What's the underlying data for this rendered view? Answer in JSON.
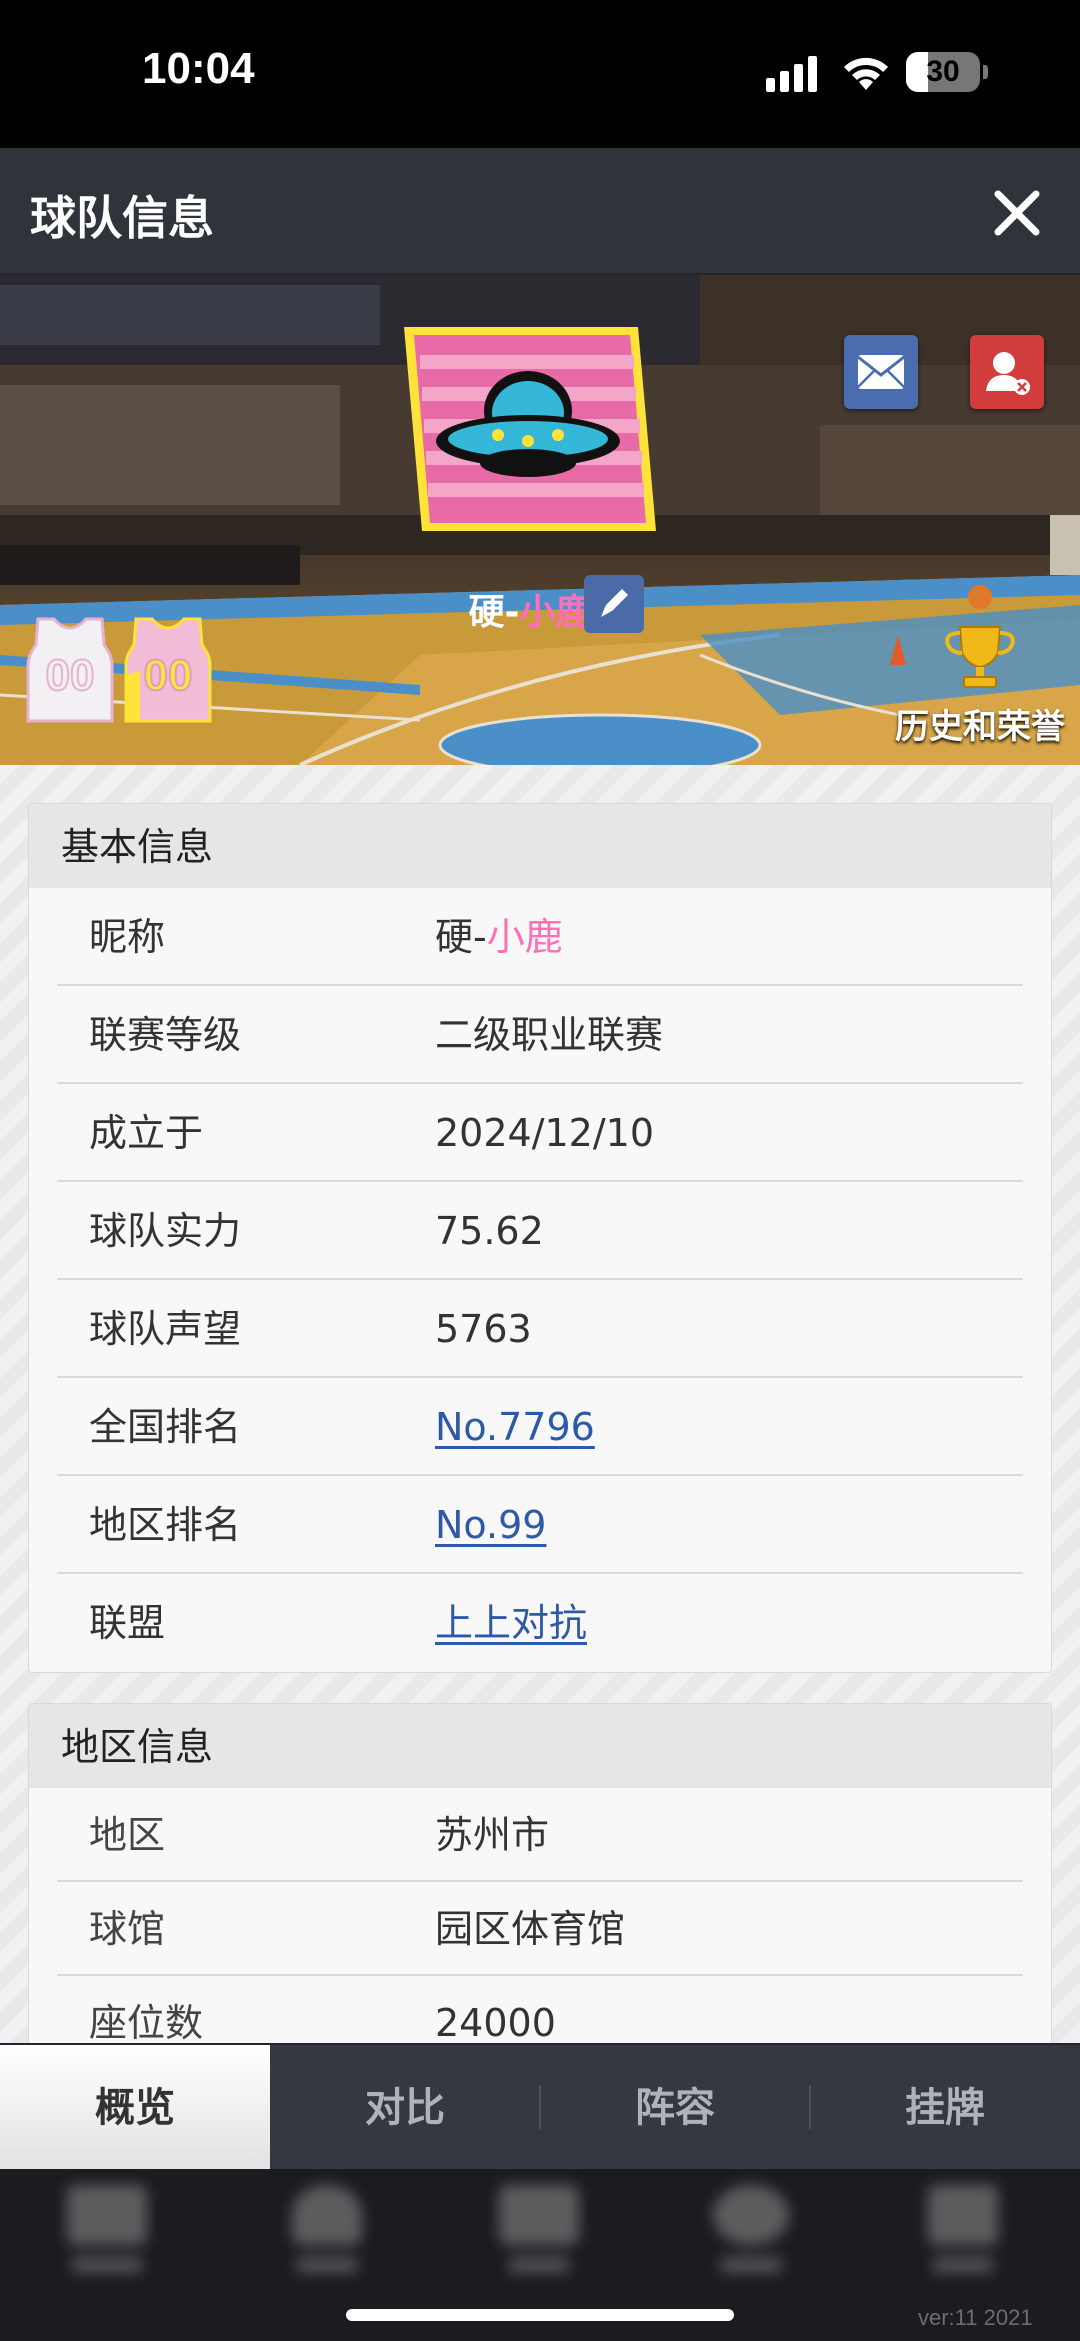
{
  "status_bar": {
    "time": "10:04",
    "battery": "30",
    "battery_level_percent": 30
  },
  "header": {
    "title": "球队信息",
    "close_icon": "close-icon"
  },
  "hero": {
    "team_name_prefix": "硬-",
    "team_name_suffix": "小鹿",
    "jersey_home_number": "00",
    "jersey_away_number": "00",
    "honor_label": "历史和荣誉",
    "icons": [
      "mail-icon",
      "user-remove-icon",
      "edit-icon",
      "trophy-icon",
      "team-logo-ufo"
    ],
    "colors": {
      "logo_pink": "#e86aa6",
      "logo_yellow": "#ffe23a",
      "name_pink": "#ff6fb7"
    }
  },
  "basic_info": {
    "heading": "基本信息",
    "rows": [
      {
        "key": "昵称",
        "value_prefix": "硬-",
        "value_suffix": "小鹿"
      },
      {
        "key": "联赛等级",
        "value": "二级职业联赛"
      },
      {
        "key": "成立于",
        "value": "2024/12/10"
      },
      {
        "key": "球队实力",
        "value": "75.62"
      },
      {
        "key": "球队声望",
        "value": "5763"
      },
      {
        "key": "全国排名",
        "value": "No.7796"
      },
      {
        "key": "地区排名",
        "value": "No.99"
      },
      {
        "key": "联盟",
        "value": "上上对抗"
      }
    ]
  },
  "region_info": {
    "heading": "地区信息",
    "rows": [
      {
        "key": "地区",
        "value": "苏州市"
      },
      {
        "key": "球馆",
        "value": "园区体育馆"
      },
      {
        "key": "座位数",
        "value": "24000"
      }
    ]
  },
  "tabs": [
    {
      "label": "概览",
      "active": true
    },
    {
      "label": "对比",
      "active": false
    },
    {
      "label": "阵容",
      "active": false
    },
    {
      "label": "挂牌",
      "active": false
    }
  ],
  "footer": {
    "version": "ver:11  2021"
  }
}
